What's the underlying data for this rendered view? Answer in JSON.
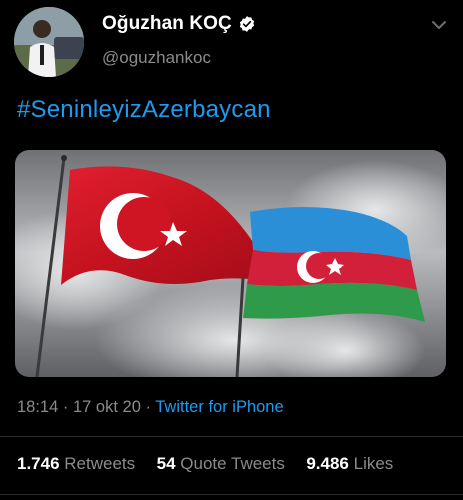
{
  "tweet": {
    "author": {
      "display_name": "Oğuzhan KOÇ",
      "handle": "@oguzhankoc",
      "verified": true,
      "avatar_icon": "profile-photo"
    },
    "text": "#SeninleyizAzerbaycan",
    "media": {
      "description_icon": "flags-image",
      "flags": [
        "turkey-flag",
        "azerbaijan-flag"
      ]
    },
    "time": "18:14",
    "date": "17 okt 20",
    "separator": "·",
    "source": "Twitter for iPhone",
    "stats": {
      "retweets_count": "1.746",
      "retweets_label": "Retweets",
      "quotes_count": "54",
      "quotes_label": "Quote Tweets",
      "likes_count": "9.486",
      "likes_label": "Likes"
    }
  },
  "colors": {
    "background": "#000000",
    "link": "#1d9bf0",
    "muted": "#8b8b8b",
    "turkey_red": "#d9182a",
    "az_blue": "#2a8fd6",
    "az_red": "#d2203a",
    "az_green": "#2e9a4a"
  }
}
